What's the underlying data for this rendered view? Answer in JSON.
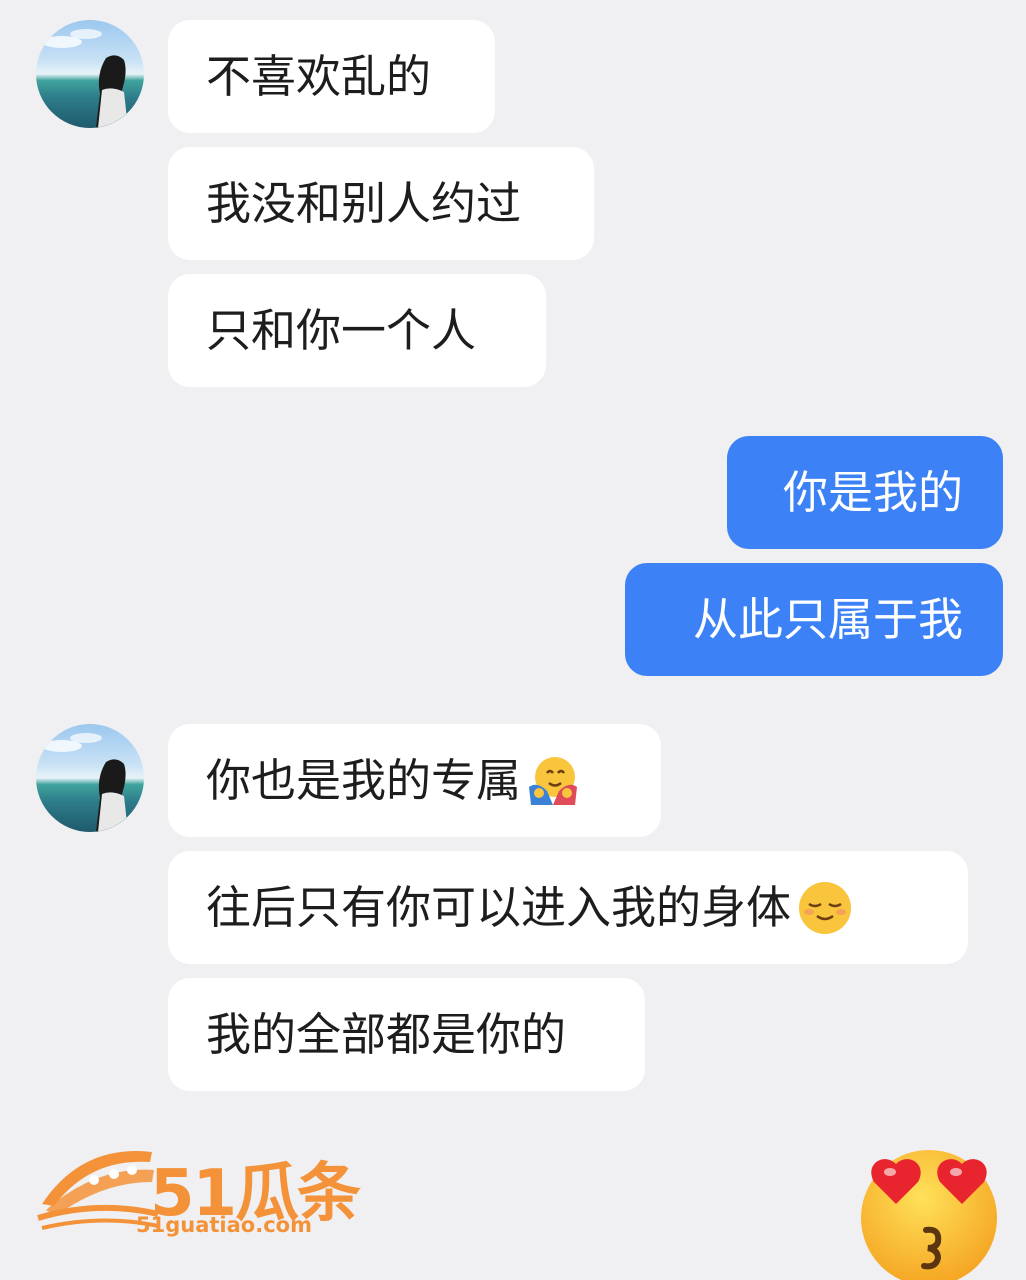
{
  "messages_group1": [
    "不喜欢乱的",
    "我没和别人约过",
    "只和你一个人"
  ],
  "messages_sent": [
    "你是我的",
    "从此只属于我"
  ],
  "messages_group2": [
    "你也是我的专属",
    "往后只有你可以进入我的身体",
    "我的全部都是你的"
  ],
  "inline_emojis": [
    "hugging-face-icon",
    "smiling-face-closed-eyes-icon"
  ],
  "watermark": {
    "name": "51瓜条",
    "url": "51guatiao.com",
    "color": "#f4923a"
  },
  "overlay_emoji": "heart-eyes-kiss-emoji-icon",
  "colors": {
    "background": "#f0f0f2",
    "incoming_bubble": "#ffffff",
    "outgoing_bubble": "#3c82f6"
  }
}
